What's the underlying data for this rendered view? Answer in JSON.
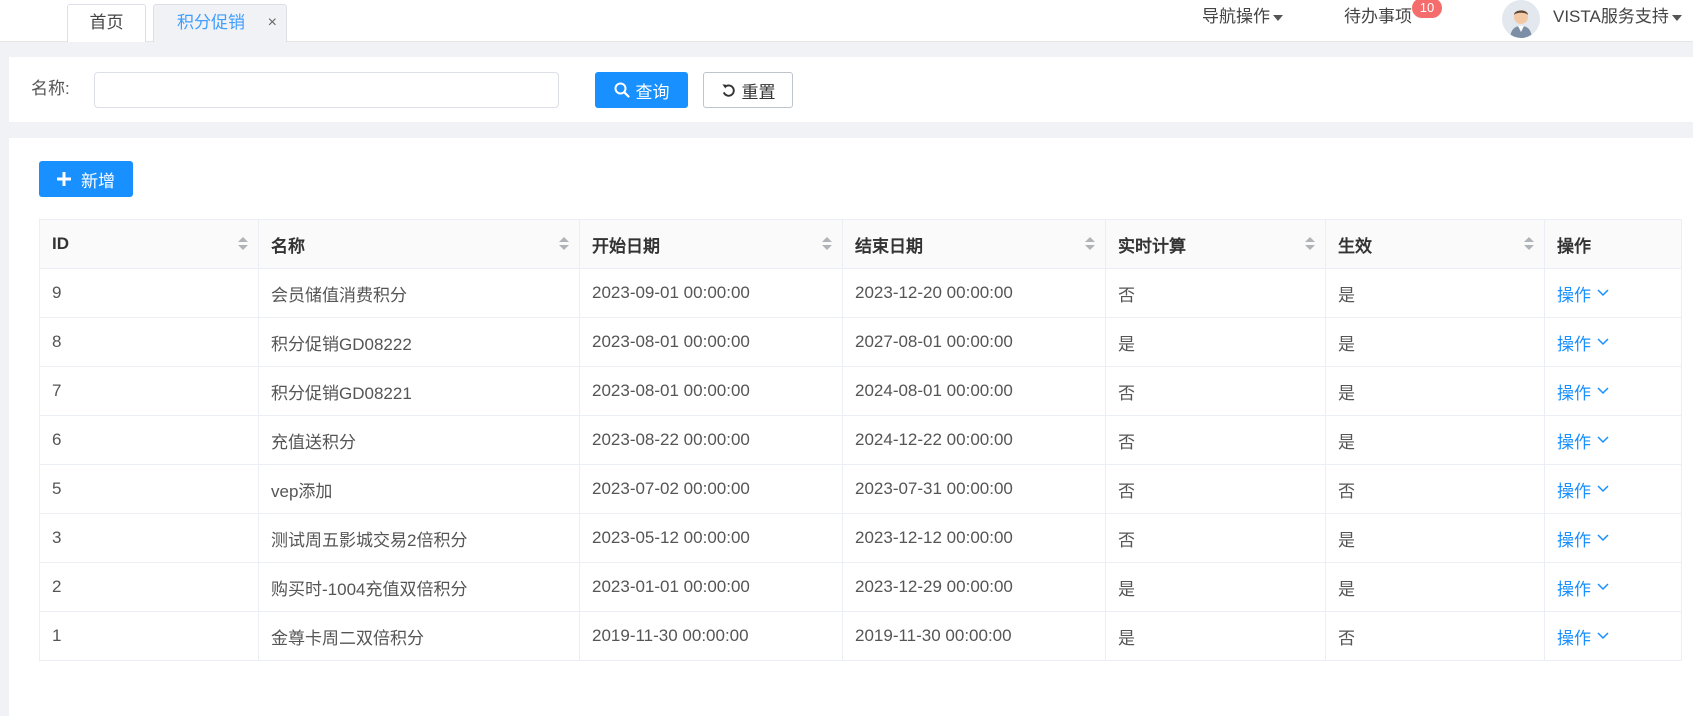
{
  "tabs": [
    {
      "label": "首页",
      "active": false
    },
    {
      "label": "积分促销",
      "active": true,
      "close": "×"
    }
  ],
  "header": {
    "nav_label": "导航操作",
    "todo_label": "待办事项",
    "todo_count": "10",
    "user_name": "VISTA服务支持"
  },
  "search": {
    "name_label": "名称:",
    "name_value": "",
    "name_placeholder": "",
    "query_label": "查询",
    "reset_label": "重置"
  },
  "toolbar": {
    "add_label": "新增"
  },
  "table": {
    "columns": [
      "ID",
      "名称",
      "开始日期",
      "结束日期",
      "实时计算",
      "生效",
      "操作"
    ],
    "rows": [
      {
        "id": "9",
        "name": "会员储值消费积分",
        "start": "2023-09-01 00:00:00",
        "end": "2023-12-20 00:00:00",
        "realtime": "否",
        "effective": "是",
        "op": "操作"
      },
      {
        "id": "8",
        "name": "积分促销GD08222",
        "start": "2023-08-01 00:00:00",
        "end": "2027-08-01 00:00:00",
        "realtime": "是",
        "effective": "是",
        "op": "操作"
      },
      {
        "id": "7",
        "name": "积分促销GD08221",
        "start": "2023-08-01 00:00:00",
        "end": "2024-08-01 00:00:00",
        "realtime": "否",
        "effective": "是",
        "op": "操作"
      },
      {
        "id": "6",
        "name": "充值送积分",
        "start": "2023-08-22 00:00:00",
        "end": "2024-12-22 00:00:00",
        "realtime": "否",
        "effective": "是",
        "op": "操作"
      },
      {
        "id": "5",
        "name": "vep添加",
        "start": "2023-07-02 00:00:00",
        "end": "2023-07-31 00:00:00",
        "realtime": "否",
        "effective": "否",
        "op": "操作"
      },
      {
        "id": "3",
        "name": "测试周五影城交易2倍积分",
        "start": "2023-05-12 00:00:00",
        "end": "2023-12-12 00:00:00",
        "realtime": "否",
        "effective": "是",
        "op": "操作"
      },
      {
        "id": "2",
        "name": "购买时-1004充值双倍积分",
        "start": "2023-01-01 00:00:00",
        "end": "2023-12-29 00:00:00",
        "realtime": "是",
        "effective": "是",
        "op": "操作"
      },
      {
        "id": "1",
        "name": "金尊卡周二双倍积分",
        "start": "2019-11-30 00:00:00",
        "end": "2019-11-30 00:00:00",
        "realtime": "是",
        "effective": "否",
        "op": "操作"
      }
    ]
  },
  "colors": {
    "primary": "#1890ff",
    "badge": "#f56c6c"
  }
}
